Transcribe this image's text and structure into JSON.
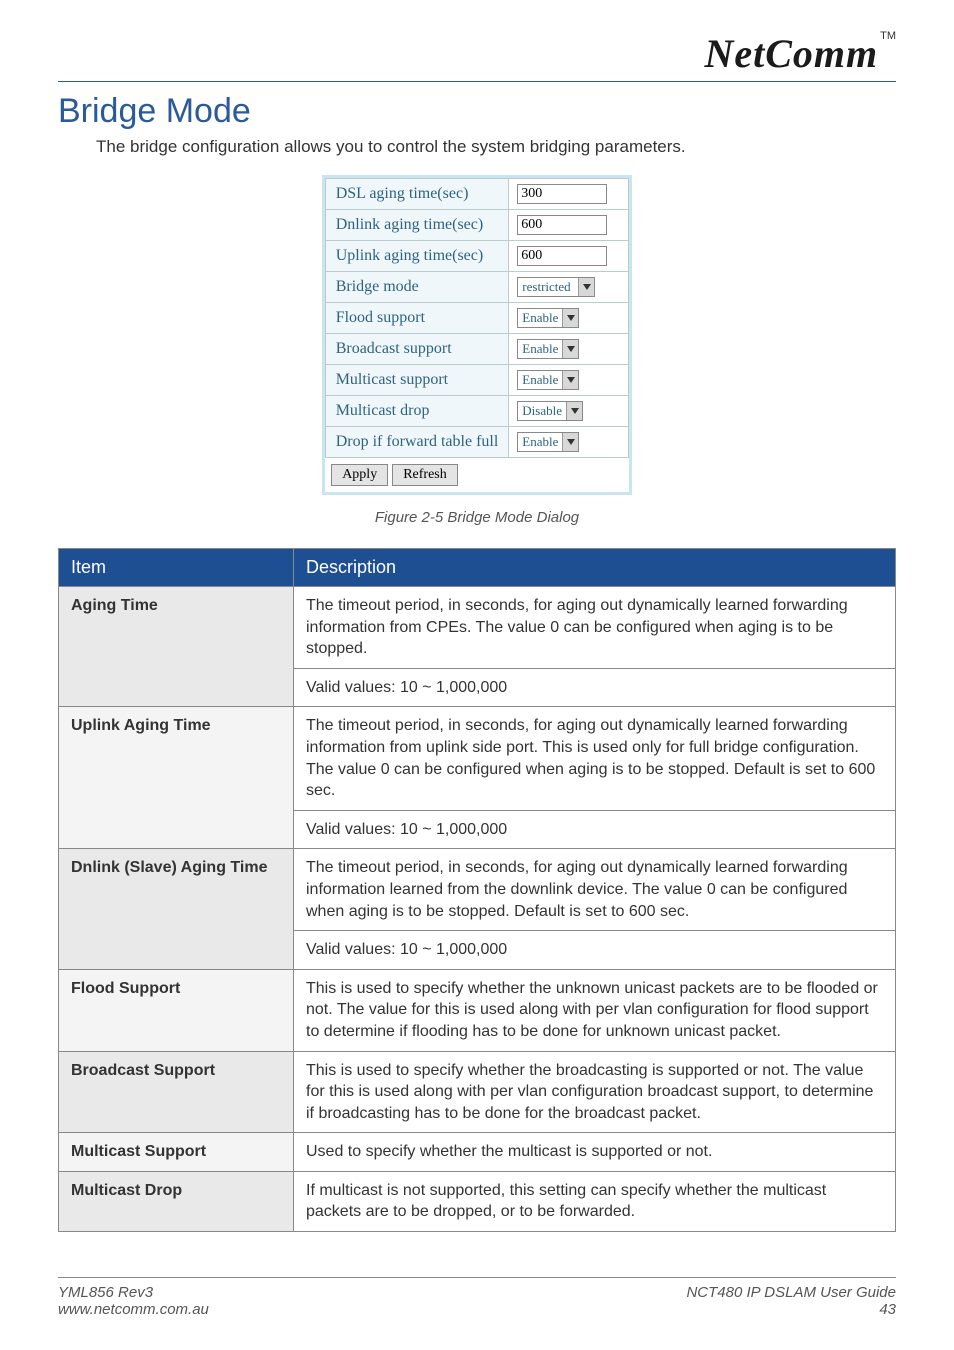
{
  "brand": {
    "name": "NetComm",
    "tm": "TM"
  },
  "page_title": "Bridge Mode",
  "intro": "The bridge configuration allows you to control the system bridging parameters.",
  "dialog": {
    "rows": [
      {
        "label": "DSL aging time(sec)",
        "type": "text",
        "value": "300"
      },
      {
        "label": "Dnlink aging time(sec)",
        "type": "text",
        "value": "600"
      },
      {
        "label": "Uplink aging time(sec)",
        "type": "text",
        "value": "600"
      },
      {
        "label": "Bridge mode",
        "type": "select",
        "value": "restricted"
      },
      {
        "label": "Flood support",
        "type": "select",
        "value": "Enable"
      },
      {
        "label": "Broadcast support",
        "type": "select",
        "value": "Enable"
      },
      {
        "label": "Multicast support",
        "type": "select",
        "value": "Enable"
      },
      {
        "label": "Multicast drop",
        "type": "select",
        "value": "Disable"
      },
      {
        "label": "Drop if forward table full",
        "type": "select",
        "value": "Enable"
      }
    ],
    "buttons": {
      "apply": "Apply",
      "refresh": "Refresh"
    }
  },
  "caption": "Figure 2-5 Bridge Mode Dialog",
  "table": {
    "headers": {
      "item": "Item",
      "desc": "Description"
    },
    "rows": [
      {
        "item": "Aging Time",
        "desc": [
          "The timeout period, in seconds, for aging out dynamically learned forwarding information from CPEs. The value 0 can be configured when aging is to be stopped.",
          "Valid values: 10 ~ 1,000,000"
        ]
      },
      {
        "item": "Uplink Aging Time",
        "desc": [
          "The timeout period, in seconds, for aging out dynamically learned forwarding information from uplink side port. This is used only for full bridge configuration. The value 0 can be configured when aging is to be stopped. Default is set to 600 sec.",
          "Valid values: 10 ~ 1,000,000"
        ]
      },
      {
        "item": "Dnlink (Slave) Aging Time",
        "desc": [
          "The timeout period, in seconds, for aging out dynamically learned forwarding information learned from the downlink device. The value 0 can be configured when aging is to be stopped. Default is set to 600 sec.",
          "Valid values: 10 ~ 1,000,000"
        ]
      },
      {
        "item": "Flood Support",
        "desc": [
          "This is used to specify whether the unknown unicast packets are to be flooded or not. The value for this is used along with per vlan configuration for flood support to determine if flooding has to be done for unknown unicast packet."
        ]
      },
      {
        "item": "Broadcast Support",
        "desc": [
          "This is used to specify whether the broadcasting is supported or not. The value for this is used along with per vlan configuration broadcast support, to determine if broadcasting has to be done for the broadcast packet."
        ]
      },
      {
        "item": "Multicast Support",
        "desc": [
          "Used to specify whether the multicast is supported or not."
        ]
      },
      {
        "item": "Multicast Drop",
        "desc": [
          "If multicast is not supported, this setting can specify whether the multicast packets are to be dropped, or to be forwarded."
        ]
      }
    ]
  },
  "footer": {
    "left1": "YML856 Rev3",
    "left2": "www.netcomm.com.au",
    "right1": "NCT480 IP DSLAM User Guide",
    "right2": "43"
  },
  "chart_data": {
    "type": "table",
    "columns": [
      "Item",
      "Description"
    ],
    "rows": [
      [
        "Aging Time",
        "The timeout period, in seconds, for aging out dynamically learned forwarding information from CPEs. The value 0 can be configured when aging is to be stopped. Valid values: 10 ~ 1,000,000"
      ],
      [
        "Uplink Aging Time",
        "The timeout period, in seconds, for aging out dynamically learned forwarding information from uplink side port. This is used only for full bridge configuration. The value 0 can be configured when aging is to be stopped. Default is set to 600 sec. Valid values: 10 ~ 1,000,000"
      ],
      [
        "Dnlink (Slave) Aging Time",
        "The timeout period, in seconds, for aging out dynamically learned forwarding information learned from the downlink device. The value 0 can be configured when aging is to be stopped. Default is set to 600 sec. Valid values: 10 ~ 1,000,000"
      ],
      [
        "Flood Support",
        "This is used to specify whether the unknown unicast packets are to be flooded or not. The value for this is used along with per vlan configuration for flood support to determine if flooding has to be done for unknown unicast packet."
      ],
      [
        "Broadcast Support",
        "This is used to specify whether the broadcasting is supported or not. The value for this is used along with per vlan configuration broadcast support, to determine if broadcasting has to be done for the broadcast packet."
      ],
      [
        "Multicast Support",
        "Used to specify whether the multicast is supported or not."
      ],
      [
        "Multicast Drop",
        "If multicast is not supported, this setting can specify whether the multicast packets are to be dropped, or to be forwarded."
      ]
    ]
  }
}
